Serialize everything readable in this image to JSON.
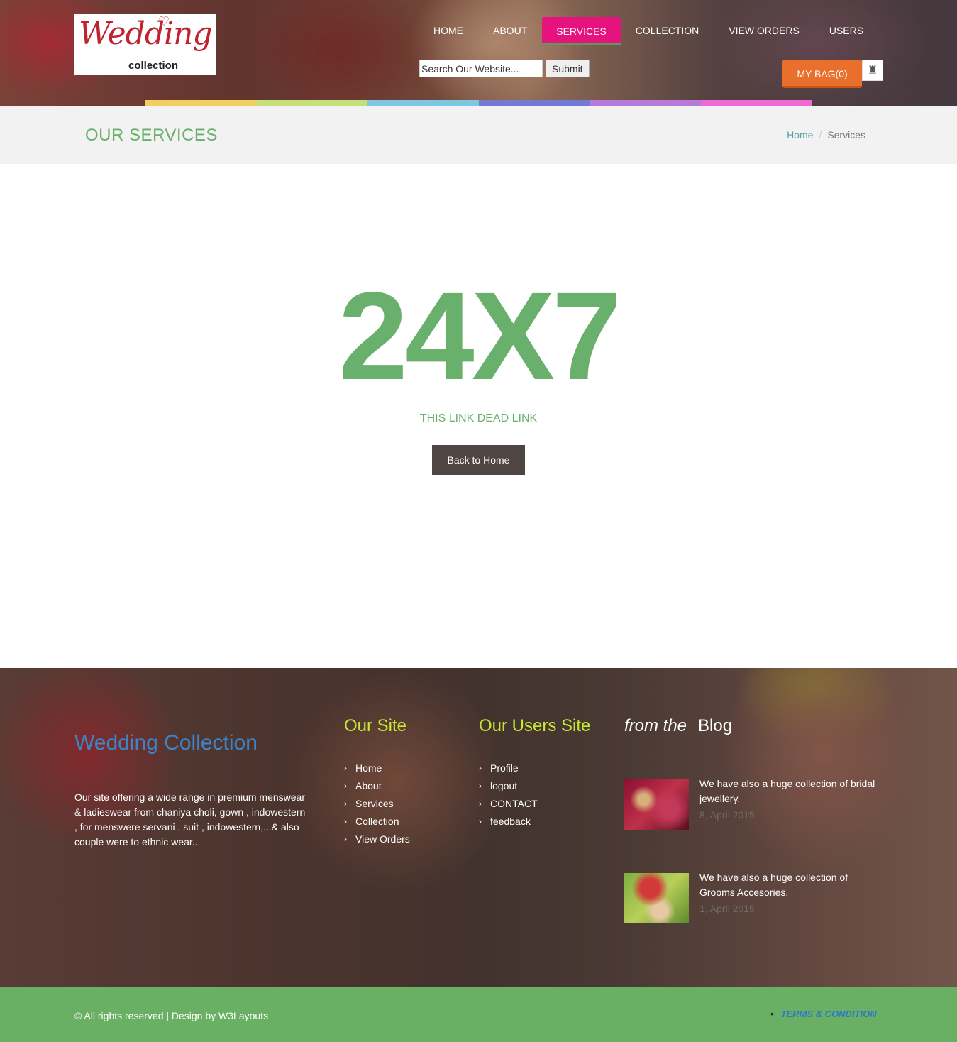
{
  "logo": {
    "script": "Wedding",
    "sub": "collection"
  },
  "nav": [
    {
      "label": "HOME"
    },
    {
      "label": "ABOUT"
    },
    {
      "label": "SERVICES"
    },
    {
      "label": "COLLECTION"
    },
    {
      "label": "VIEW ORDERS"
    },
    {
      "label": "USERS"
    }
  ],
  "search": {
    "value": "Search Our Website...",
    "submit_label": "Submit"
  },
  "bag": {
    "label": "MY BAG(0)"
  },
  "stripe_colors": [
    "#f2cf63",
    "#c5e07b",
    "#7dc8e0",
    "#7479d6",
    "#b67ad9",
    "#ef6ad4"
  ],
  "page": {
    "title": "OUR SERVICES"
  },
  "breadcrumb": {
    "home": "Home",
    "sep": "/",
    "current": "Services"
  },
  "main": {
    "big": "24X7",
    "message": "THIS LINK DEAD LINK",
    "back_label": "Back to Home"
  },
  "footer": {
    "brand": "Wedding Collection",
    "about": "Our site offering a wide range in premium menswear & ladieswear from chaniya choli, gown , indowestern , for menswere servani , suit , indowestern,...& also couple were to ethnic wear..",
    "site_heading": "Our Site",
    "site_links": [
      "Home",
      "About",
      "Services",
      "Collection",
      "View Orders"
    ],
    "users_heading": "Our Users Site",
    "users_links": [
      "Profile",
      "logout",
      "CONTACT",
      "feedback"
    ],
    "blog_prefix": "from the",
    "blog_heading": "Blog",
    "posts": [
      {
        "text": "We have also a huge collection of bridal jewellery.",
        "date": "8, April 2015"
      },
      {
        "text": "We have also a huge collection of Grooms Accesories.",
        "date": "1, April 2015"
      }
    ]
  },
  "bottom": {
    "copyright": "© All rights reserved | Design by W3Layouts",
    "terms": "TERMS & CONDITION"
  },
  "colors": {
    "accent_green": "#6ab06d",
    "nav_active": "#e6127e",
    "bag": "#e96f2d",
    "brand_blue": "#3f83c9",
    "footer_heading": "#c6e634"
  }
}
